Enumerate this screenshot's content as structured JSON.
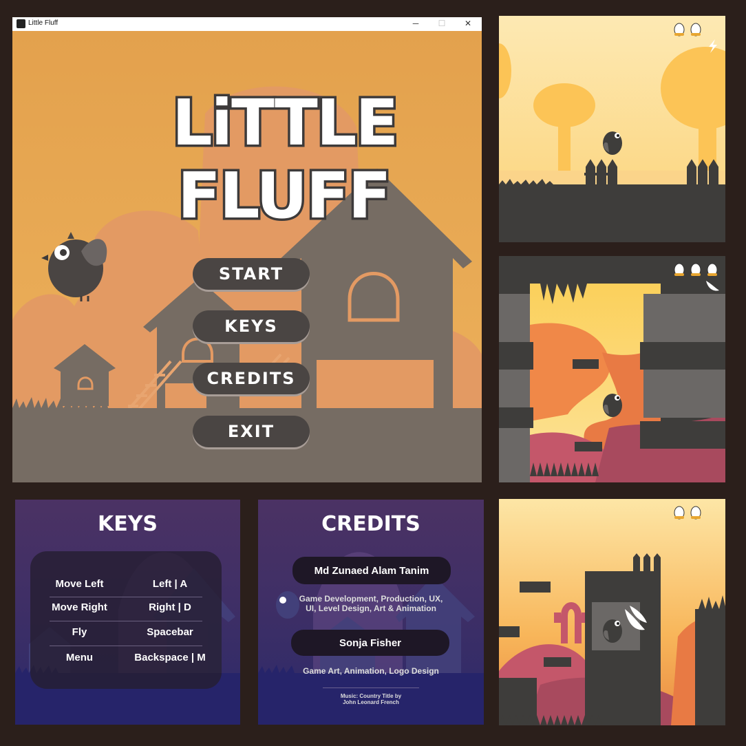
{
  "window": {
    "title": "Little Fluff",
    "minimize": "─",
    "maximize": "☐",
    "close": "✕"
  },
  "logo": {
    "line1": "LiTTLE",
    "line2": "FLUFF"
  },
  "menu": {
    "start": "START",
    "keys": "KEYS",
    "credits": "CREDITS",
    "exit": "EXIT"
  },
  "keys": {
    "title": "KEYS",
    "rows": [
      {
        "action": "Move Left",
        "key": "Left | A"
      },
      {
        "action": "Move Right",
        "key": "Right | D"
      },
      {
        "action": "Fly",
        "key": "Spacebar"
      },
      {
        "action": "Menu",
        "key": "Backspace | M"
      }
    ]
  },
  "credits": {
    "title": "CREDITS",
    "person1": "Md Zunaed Alam Tanim",
    "role1_line1": "Game Development, Production, UX,",
    "role1_line2": "UI, Level Design, Art & Animation",
    "person2": "Sonja Fisher",
    "role2": "Game Art, Animation, Logo Design",
    "music_line1": "Music: Country Title by",
    "music_line2": "John Leonard French"
  },
  "hud": {
    "level1": {
      "eggs": 2,
      "powerup": "lightning-icon"
    },
    "level2": {
      "eggs": 3,
      "powerup": "wing-icon"
    },
    "level3": {
      "eggs": 2,
      "powerup": "wing-icon"
    }
  },
  "colors": {
    "sky": "#e5a54f",
    "ground": "#726a63",
    "buttons": "#4a4543",
    "purple": "#3f2f66"
  }
}
